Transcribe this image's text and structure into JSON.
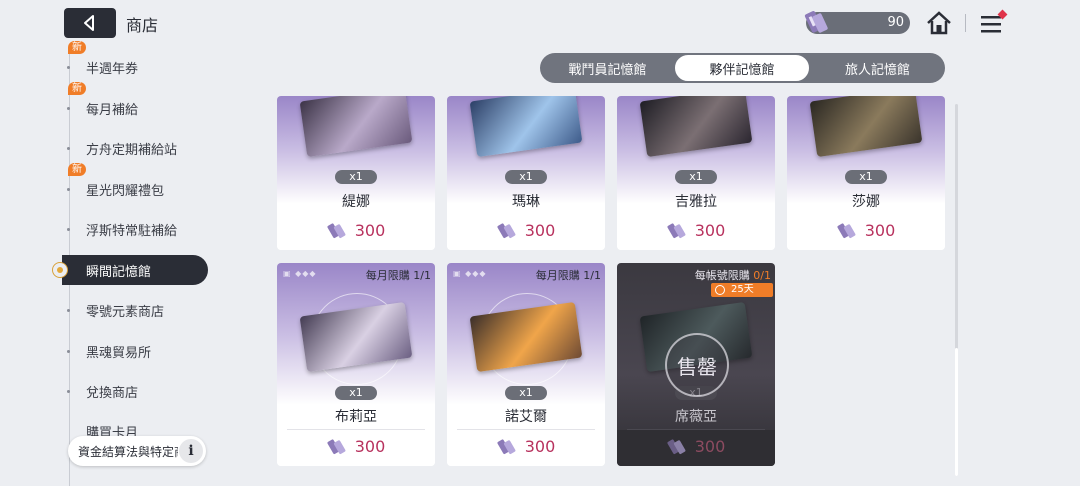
{
  "header": {
    "title": "商店",
    "currency_value": "90"
  },
  "icons": {
    "back": "back-arrow-icon",
    "currency": "crystal-currency-icon",
    "home": "home-icon",
    "menu": "menu-icon"
  },
  "sidebar": {
    "items": [
      {
        "label": "半週年券",
        "badge": "新"
      },
      {
        "label": "每月補給",
        "badge": "新"
      },
      {
        "label": "方舟定期補給站"
      },
      {
        "label": "星光閃耀禮包",
        "badge": "新"
      },
      {
        "label": "浮斯特常駐補給"
      },
      {
        "label": "瞬間記憶館",
        "active": true
      },
      {
        "label": "零號元素商店"
      },
      {
        "label": "黑魂貿易所"
      },
      {
        "label": "兌換商店"
      },
      {
        "label": "購買卡月"
      }
    ],
    "info_text": "資金結算法與特定商交易"
  },
  "tabs": [
    "戰鬥員記憶館",
    "夥伴記憶館",
    "旅人記憶館"
  ],
  "selected_tab": "夥伴記憶館",
  "cards": [
    {
      "name": "緹娜",
      "qty": "x1",
      "price": "300"
    },
    {
      "name": "瑪琳",
      "qty": "x1",
      "price": "300"
    },
    {
      "name": "吉雅拉",
      "qty": "x1",
      "price": "300"
    },
    {
      "name": "莎娜",
      "qty": "x1",
      "price": "300"
    },
    {
      "name": "布莉亞",
      "qty": "x1",
      "price": "300",
      "limit": "每月限購 1/1"
    },
    {
      "name": "諾艾爾",
      "qty": "x1",
      "price": "300",
      "limit": "每月限購 1/1"
    },
    {
      "name": "席薇亞",
      "qty": "x1",
      "price": "300",
      "limit_prefix": "每帳號限購 ",
      "limit_count": "0/1",
      "timer": "25天",
      "sold_label": "售罄"
    }
  ],
  "colors": {
    "accent": "#f07d28",
    "price": "#b8325e",
    "dark": "#2a2d36"
  }
}
